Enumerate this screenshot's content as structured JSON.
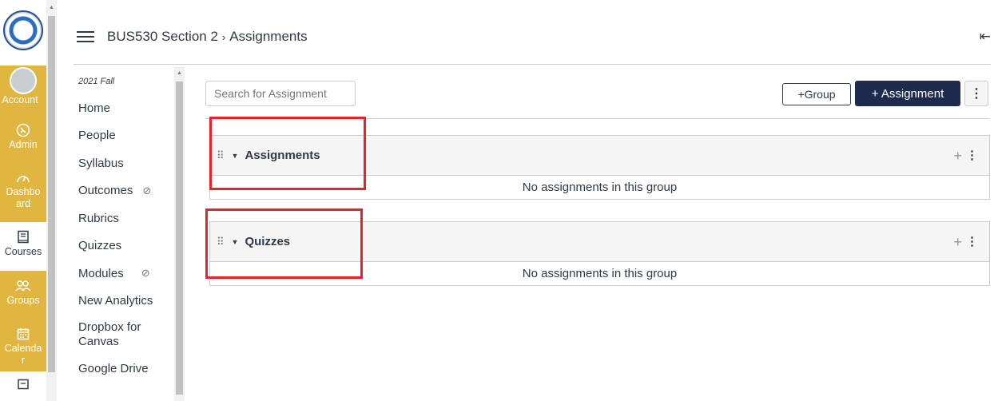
{
  "global_nav": {
    "items": [
      {
        "label": "Account",
        "icon": "avatar-icon"
      },
      {
        "label": "Admin",
        "icon": "shield-icon"
      },
      {
        "label": "Dashbo ard",
        "icon": "dashboard-icon"
      },
      {
        "label": "Courses",
        "icon": "book-icon"
      },
      {
        "label": "Groups",
        "icon": "groups-icon"
      },
      {
        "label": "Calenda r",
        "icon": "calendar-icon"
      }
    ],
    "accent_color": "#e0b640"
  },
  "header": {
    "course": "BUS530 Section 2",
    "separator": "›",
    "page": "Assignments"
  },
  "course_nav": {
    "term": "2021 Fall",
    "items": [
      {
        "label": "Home"
      },
      {
        "label": "People"
      },
      {
        "label": "Syllabus"
      },
      {
        "label": "Outcomes"
      },
      {
        "label": "Rubrics"
      },
      {
        "label": "Quizzes"
      },
      {
        "label": "Modules"
      },
      {
        "label": "New Analytics"
      },
      {
        "label": "Dropbox for Canvas"
      },
      {
        "label": "Google Drive"
      }
    ]
  },
  "toolbar": {
    "search_placeholder": "Search for Assignment",
    "group_button": "+Group",
    "assignment_button": "+ Assignment",
    "more": "⋮"
  },
  "groups": [
    {
      "name": "Assignments",
      "empty_text": "No assignments in this group"
    },
    {
      "name": "Quizzes",
      "empty_text": "No assignments in this group"
    }
  ],
  "highlight_color": "#e3242b"
}
